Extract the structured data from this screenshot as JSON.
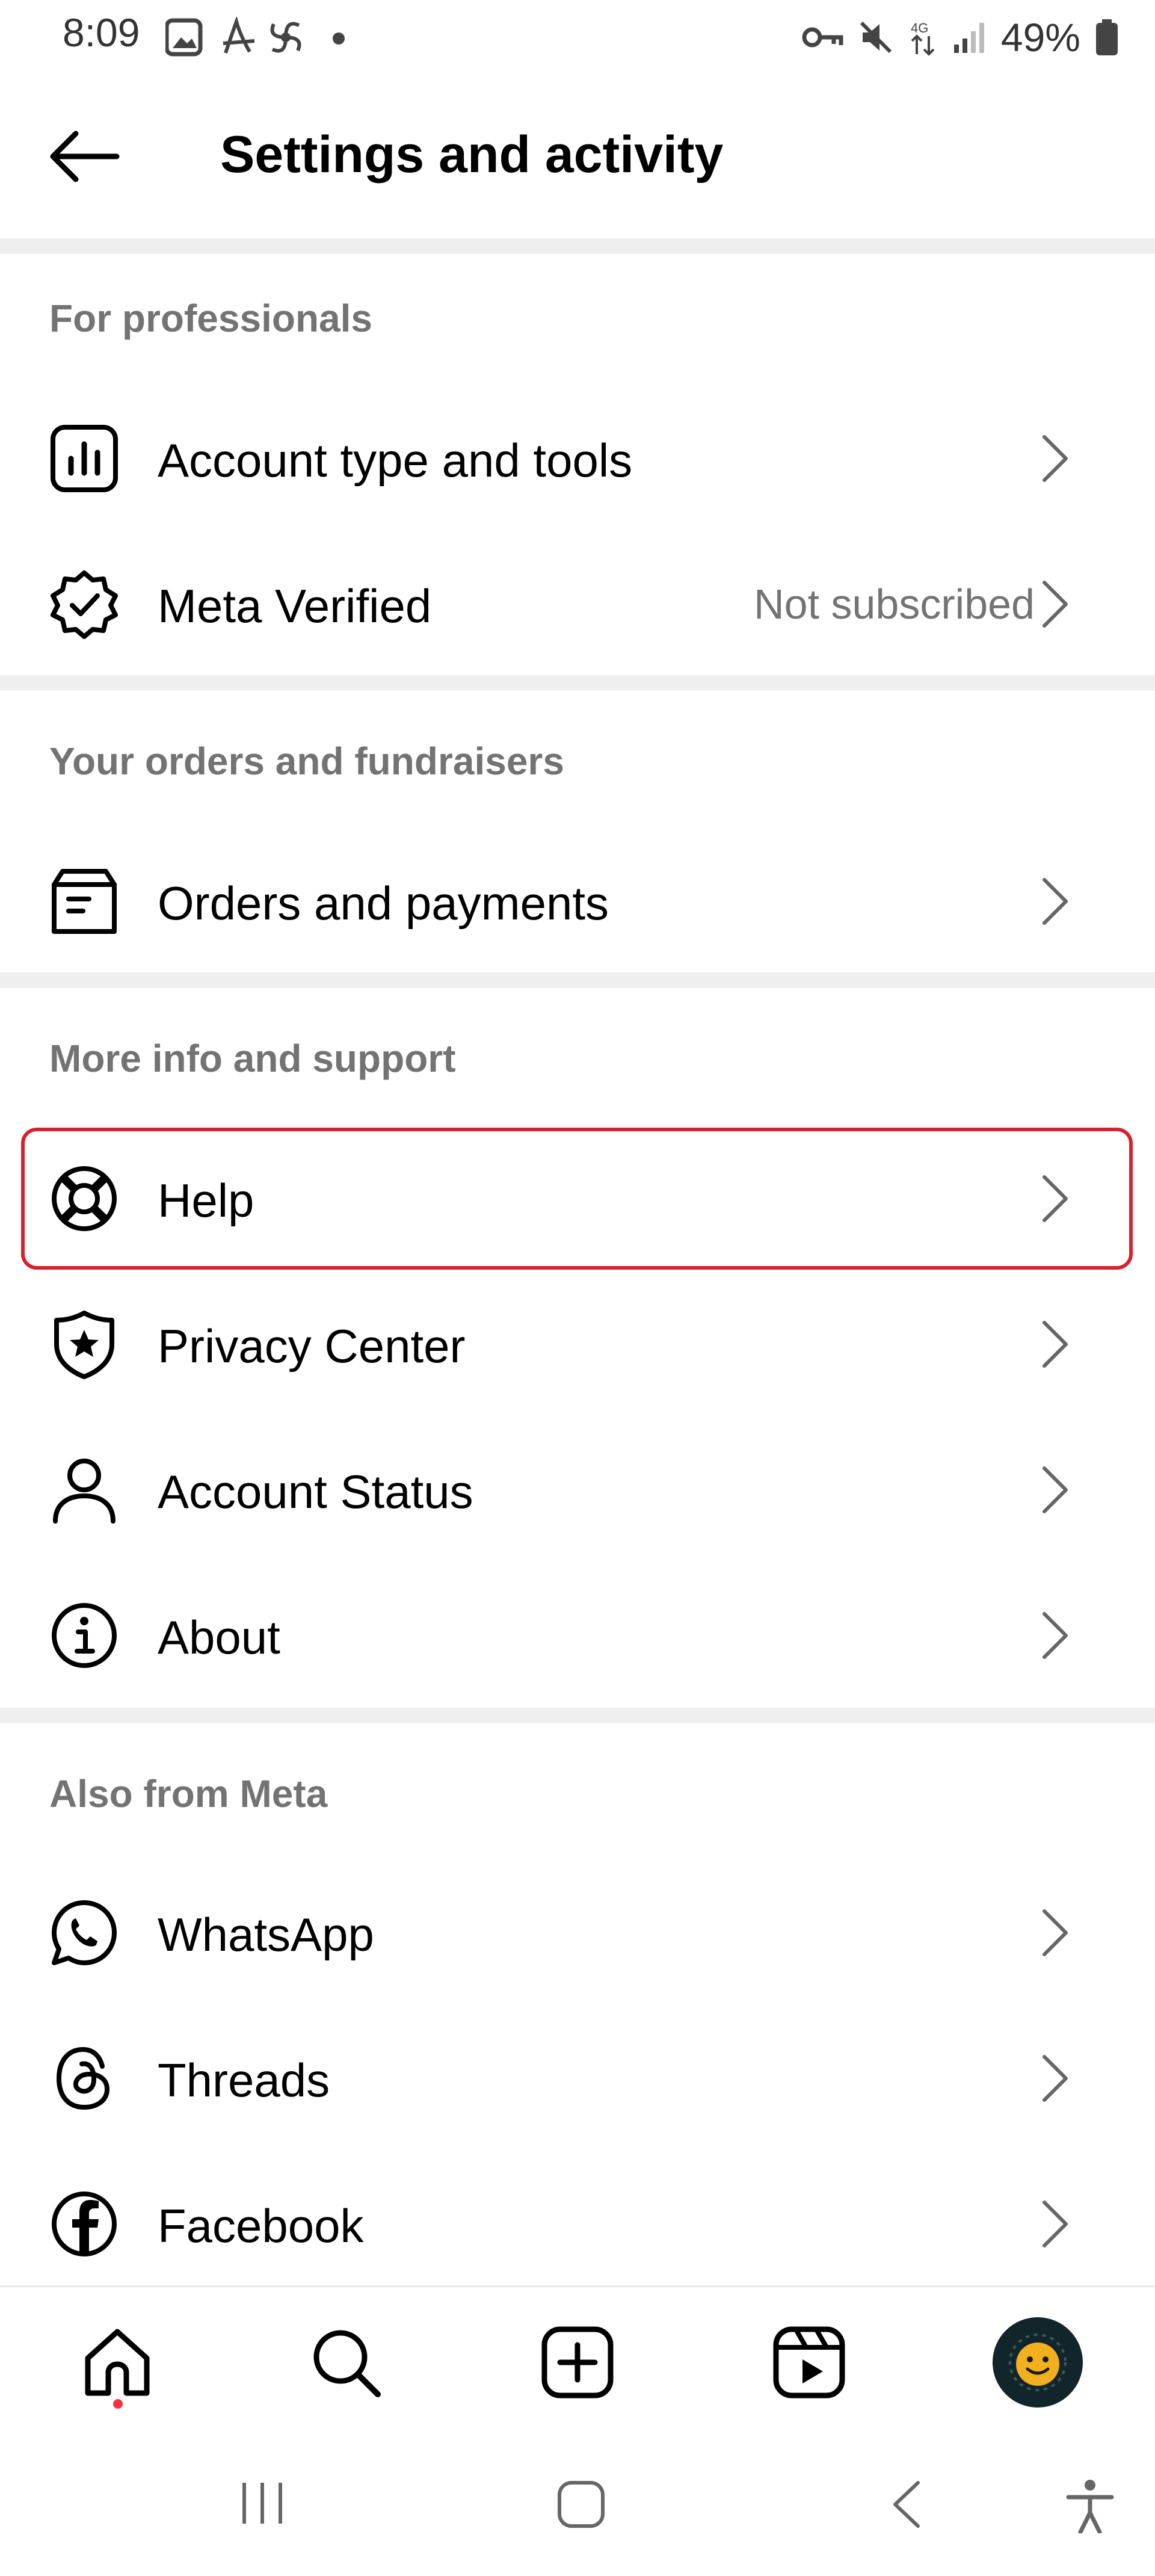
{
  "status": {
    "time": "8:09",
    "battery": "49%"
  },
  "header": {
    "title": "Settings and activity"
  },
  "sections": {
    "professionals": {
      "title": "For professionals",
      "items": [
        {
          "label": "Account type and tools",
          "icon": "bar-chart-icon"
        },
        {
          "label": "Meta Verified",
          "trailing": "Not subscribed",
          "icon": "verified-badge-icon"
        }
      ]
    },
    "orders": {
      "title": "Your orders and fundraisers",
      "items": [
        {
          "label": "Orders and payments",
          "icon": "orders-icon"
        }
      ]
    },
    "support": {
      "title": "More info and support",
      "items": [
        {
          "label": "Help",
          "icon": "lifebuoy-icon"
        },
        {
          "label": "Privacy Center",
          "icon": "shield-star-icon"
        },
        {
          "label": "Account Status",
          "icon": "person-icon"
        },
        {
          "label": "About",
          "icon": "info-icon"
        }
      ]
    },
    "meta": {
      "title": "Also from Meta",
      "items": [
        {
          "label": "WhatsApp",
          "icon": "whatsapp-icon"
        },
        {
          "label": "Threads",
          "icon": "threads-icon"
        },
        {
          "label": "Facebook",
          "icon": "facebook-icon"
        }
      ]
    }
  },
  "colors": {
    "highlight": "#d8202e",
    "secondary_text": "#737373",
    "divider": "#efefef",
    "notification_dot": "#ff3040"
  }
}
